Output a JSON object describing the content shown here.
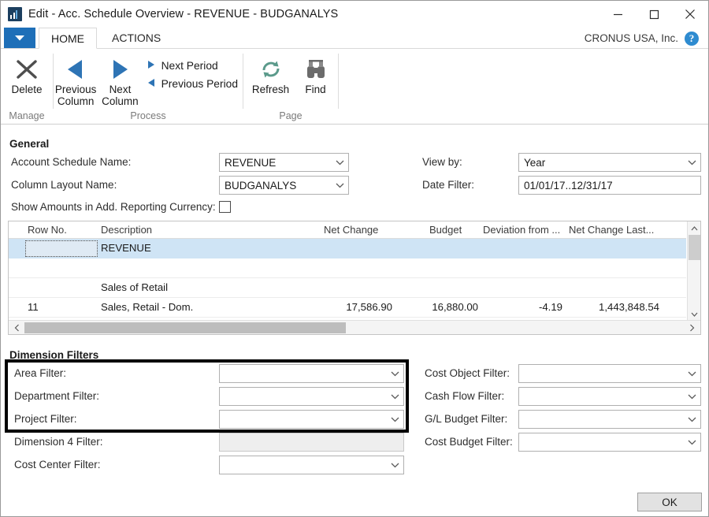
{
  "window": {
    "title": "Edit - Acc. Schedule Overview - REVENUE - BUDGANALYS",
    "app_icon": "chart-icon",
    "minimize": "−",
    "maximize": "□",
    "close": "✕"
  },
  "ribbon": {
    "dropdown_label": "▼",
    "tabs": [
      {
        "label": "HOME",
        "active": true
      },
      {
        "label": "ACTIONS",
        "active": false
      }
    ],
    "company": "CRONUS USA, Inc.",
    "help": "?",
    "groups": [
      {
        "label": "Manage",
        "buttons": [
          {
            "label": "Delete",
            "icon": "delete-x-icon"
          }
        ]
      },
      {
        "label": "Process",
        "buttons": [
          {
            "label": "Previous Column",
            "icon": "left-triangle-icon"
          },
          {
            "label": "Next Column",
            "icon": "right-triangle-icon"
          }
        ],
        "small_buttons": [
          {
            "label": "Next Period",
            "icon": "right-triangle-small-icon"
          },
          {
            "label": "Previous Period",
            "icon": "left-triangle-small-icon"
          }
        ]
      },
      {
        "label": "Page",
        "buttons": [
          {
            "label": "Refresh",
            "icon": "refresh-icon"
          },
          {
            "label": "Find",
            "icon": "binoculars-icon"
          }
        ]
      }
    ]
  },
  "general": {
    "heading": "General",
    "account_schedule_name": {
      "label": "Account Schedule Name:",
      "value": "REVENUE"
    },
    "column_layout_name": {
      "label": "Column Layout Name:",
      "value": "BUDGANALYS"
    },
    "show_amounts_add_reporting_currency": {
      "label": "Show Amounts in Add. Reporting Currency:",
      "checked": false
    },
    "view_by": {
      "label": "View by:",
      "value": "Year"
    },
    "date_filter": {
      "label": "Date Filter:",
      "value": "01/01/17..12/31/17"
    }
  },
  "grid": {
    "columns": [
      "Row No.",
      "Description",
      "Net Change",
      "Budget",
      "Deviation from ...",
      "Net Change Last..."
    ],
    "rows": [
      {
        "row_no": "",
        "description": "REVENUE",
        "net_change": "",
        "budget": "",
        "deviation": "",
        "net_change_last": "",
        "selected": true
      },
      {
        "row_no": "",
        "description": "",
        "net_change": "",
        "budget": "",
        "deviation": "",
        "net_change_last": "",
        "selected": false
      },
      {
        "row_no": "",
        "description": "Sales of Retail",
        "net_change": "",
        "budget": "",
        "deviation": "",
        "net_change_last": "",
        "selected": false
      },
      {
        "row_no": "11",
        "description": "Sales, Retail - Dom.",
        "net_change": "17,586.90",
        "budget": "16,880.00",
        "deviation": "-4.19",
        "net_change_last": "1,443,848.54",
        "selected": false
      }
    ]
  },
  "dimension_filters": {
    "heading": "Dimension Filters",
    "left": [
      {
        "label": "Area Filter:",
        "value": "",
        "disabled": false
      },
      {
        "label": "Department Filter:",
        "value": "",
        "disabled": false
      },
      {
        "label": "Project Filter:",
        "value": "",
        "disabled": false
      },
      {
        "label": "Dimension 4 Filter:",
        "value": "",
        "disabled": true
      },
      {
        "label": "Cost Center Filter:",
        "value": "",
        "disabled": false
      }
    ],
    "right": [
      {
        "label": "Cost Object Filter:",
        "value": "",
        "disabled": false
      },
      {
        "label": "Cash Flow Filter:",
        "value": "",
        "disabled": false
      },
      {
        "label": "G/L Budget Filter:",
        "value": "",
        "disabled": false
      },
      {
        "label": "Cost Budget Filter:",
        "value": "",
        "disabled": false
      }
    ]
  },
  "footer": {
    "ok_label": "OK"
  },
  "colors": {
    "ribbon_blue": "#1e6fb8",
    "selection_blue": "#cfe4f5",
    "refresh_green": "#5b9a8b",
    "accent_triangle": "#2e74b5",
    "highlight_box": "#000000"
  }
}
